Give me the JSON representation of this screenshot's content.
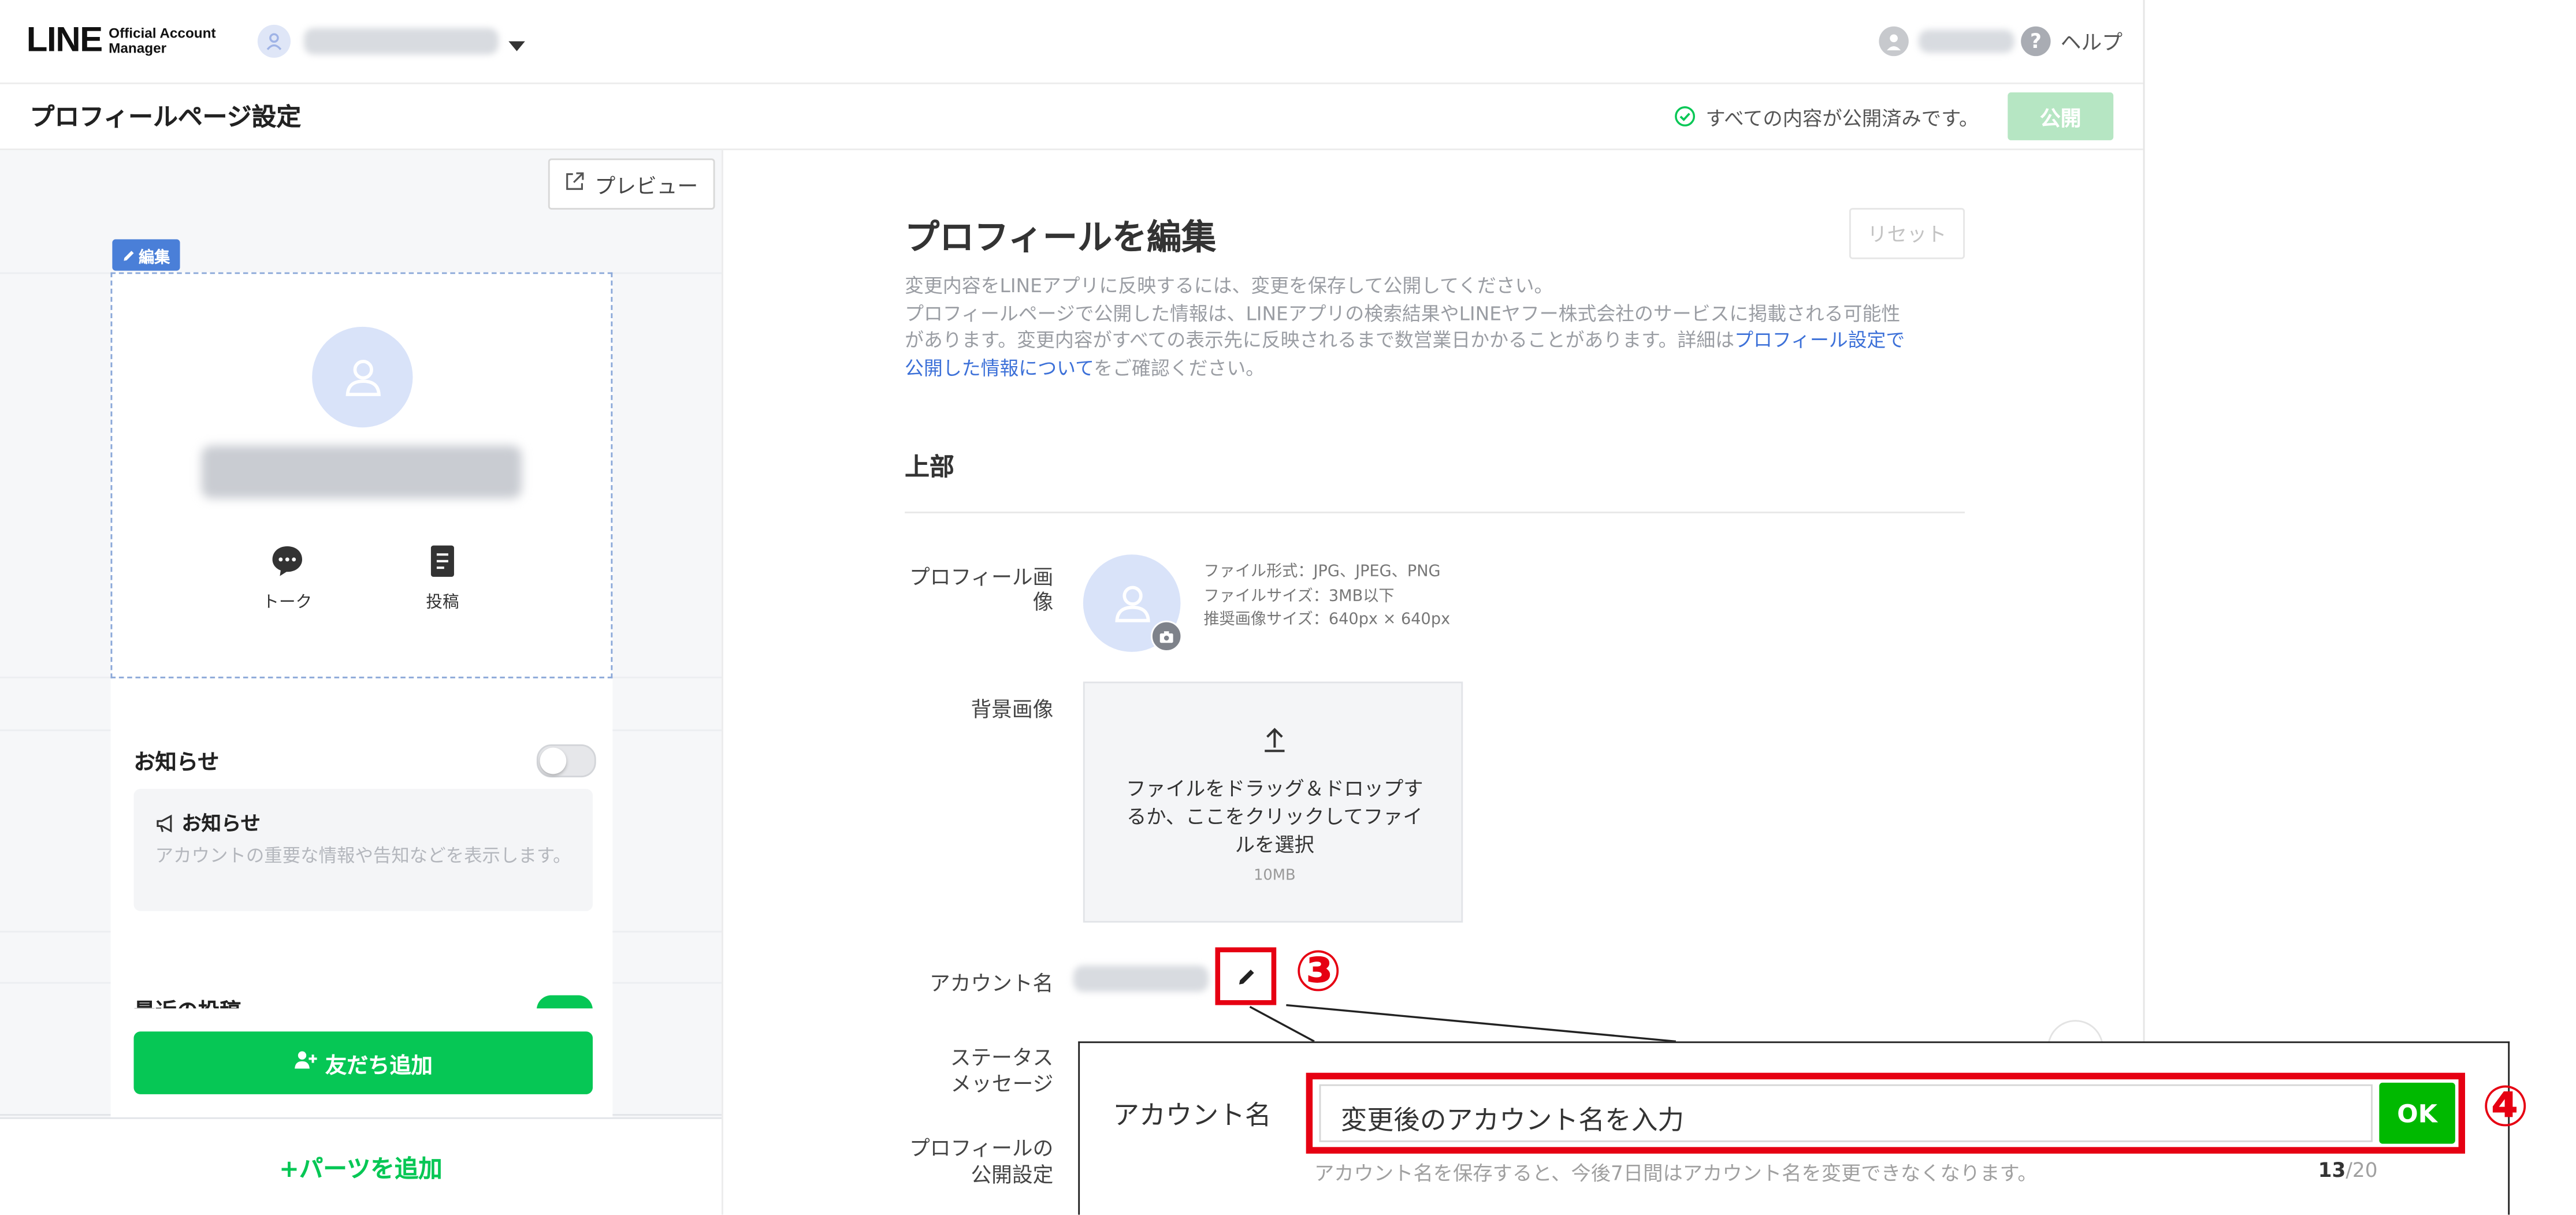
{
  "app": {
    "logo_main": "LINE",
    "logo_sub1": "Official Account",
    "logo_sub2": "Manager",
    "help_label": "ヘルプ"
  },
  "subheader": {
    "title": "プロフィールページ設定",
    "status_text": "すべての内容が公開済みです。",
    "publish_label": "公開"
  },
  "preview": {
    "preview_label": "プレビュー",
    "edit_tag": "編集",
    "actions": [
      {
        "label": "トーク",
        "icon": "chat-bubble-icon"
      },
      {
        "label": "投稿",
        "icon": "document-icon"
      }
    ],
    "notice_section": {
      "title": "お知らせ",
      "card_title": "お知らせ",
      "card_desc": "アカウントの重要な情報や告知などを表示します。"
    },
    "recent_posts_label": "最近の投稿",
    "add_friend_label": "友だち追加",
    "add_parts_label": "+パーツを追加"
  },
  "editor": {
    "title": "プロフィールを編集",
    "reset_label": "リセット",
    "desc_line1": "変更内容をLINEアプリに反映するには、変更を保存して公開してください。",
    "desc_line2": "プロフィールページで公開した情報は、LINEアプリの検索結果やLINEヤフー株式会社のサービスに掲載される可能性",
    "desc_line3a": "があります。変更内容がすべての表示先に反映されるまで数営業日かかることがあります。詳細は",
    "desc_link_a": "プロフィール設定で",
    "desc_link_b": "公開した情報について",
    "desc_line4": "をご確認ください。",
    "section_top": "上部",
    "profile_image_label_1": "プロフィール画",
    "profile_image_label_2": "像",
    "image_info": [
      "ファイル形式：JPG、JPEG、PNG",
      "ファイルサイズ：3MB以下",
      "推奨画像サイズ：640px × 640px"
    ],
    "bg_label": "背景画像",
    "upload_line1": "ファイルをドラッグ＆ドロップす",
    "upload_line2": "るか、ここをクリックしてファイ",
    "upload_line3": "ルを選択",
    "upload_size": "10MB",
    "account_name_label": "アカウント名",
    "status_label_1": "ステータス",
    "status_label_2": "メッセージ",
    "profile_public_label_1": "プロフィールの",
    "profile_public_label_2": "公開設定"
  },
  "popup": {
    "label": "アカウント名",
    "placeholder": "変更後のアカウント名を入力",
    "ok_label": "OK",
    "note": "アカウント名を保存すると、今後7日間はアカウント名を変更できなくなります。",
    "count_current": "13",
    "count_max": "/20"
  },
  "annotations": {
    "step3": "③",
    "step4": "④"
  },
  "colors": {
    "line_green": "#06c755",
    "ok_green": "#00b900",
    "link_blue": "#3c70d8",
    "highlight_red": "#e60012",
    "publish_disabled": "#b6e6c3"
  }
}
